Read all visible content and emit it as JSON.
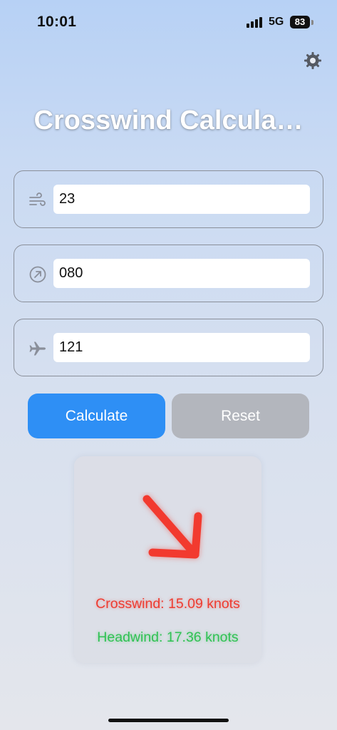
{
  "status_bar": {
    "time": "10:01",
    "network": "5G",
    "battery": "83"
  },
  "header": {
    "title": "Crosswind Calcula…",
    "settings_icon": "gear-icon"
  },
  "inputs": {
    "wind_speed": {
      "icon": "wind-icon",
      "value": "23"
    },
    "wind_direction": {
      "icon": "direction-arrow-icon",
      "value": "080"
    },
    "runway_heading": {
      "icon": "airplane-icon",
      "value": "121"
    }
  },
  "actions": {
    "calculate_label": "Calculate",
    "reset_label": "Reset"
  },
  "result": {
    "arrow_icon": "wind-direction-arrow-icon",
    "crosswind": "Crosswind: 15.09 knots",
    "headwind": "Headwind: 17.36 knots"
  },
  "colors": {
    "accent": "#2e8ff5",
    "reset": "#b3b6bd",
    "crosswind": "#ee3b30",
    "headwind": "#2fc253"
  }
}
